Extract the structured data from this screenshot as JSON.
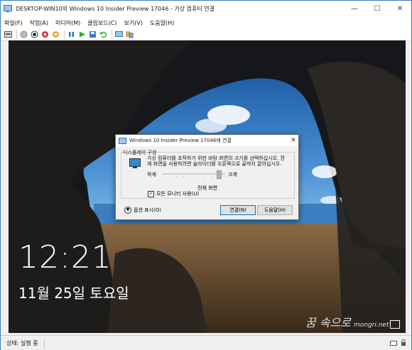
{
  "window": {
    "title": "DESKTOP-WIN10의 Windows 10 Insider Preview 17046 - 가상 컴퓨터 연결",
    "controls": {
      "minimize": "—",
      "maximize": "☐",
      "close": "✕"
    }
  },
  "menu": {
    "items": [
      "파일(F)",
      "작업(A)",
      "미디어(M)",
      "클립보드(C)",
      "보기(V)",
      "도움말(H)"
    ]
  },
  "toolbar": {
    "icons": [
      "ctrl-alt-del-icon",
      "start-icon",
      "turn-off-icon",
      "shutdown-icon",
      "reset-icon",
      "pause-icon",
      "resume-icon",
      "save-icon",
      "revert-icon",
      "enhanced-session-icon",
      "share-icon"
    ]
  },
  "lockscreen": {
    "time": "12:21",
    "date": "11월 25일 토요일"
  },
  "watermark": {
    "text": "꿈 속으로",
    "site": "mongri.net"
  },
  "status": {
    "text": "상태: 실행 중"
  },
  "dialog": {
    "title": "Windows 10 Insider Preview 17046에 연결",
    "close": "✕",
    "group_label": "디스플레이 구성",
    "description": "가상 컴퓨터를 조작하기 위한 바탕 화면의 크기를 선택하십시오. 전체 화면을 사용하려면 슬라이더를 오른쪽으로 끝까지 끌어십시오.",
    "small_label": "작게",
    "large_label": "크게",
    "fullscreen_label": "전체 화면",
    "all_monitors_label": "모든 모니터 사용(U)",
    "all_monitors_checked": "✓",
    "slider_level": 0.9,
    "options_label": "옵션 표시(O)",
    "connect_button": "연결(N)",
    "help_button": "도움말(H)"
  },
  "colors": {
    "accent": "#0078d7",
    "sky": "#2f6fb5"
  }
}
